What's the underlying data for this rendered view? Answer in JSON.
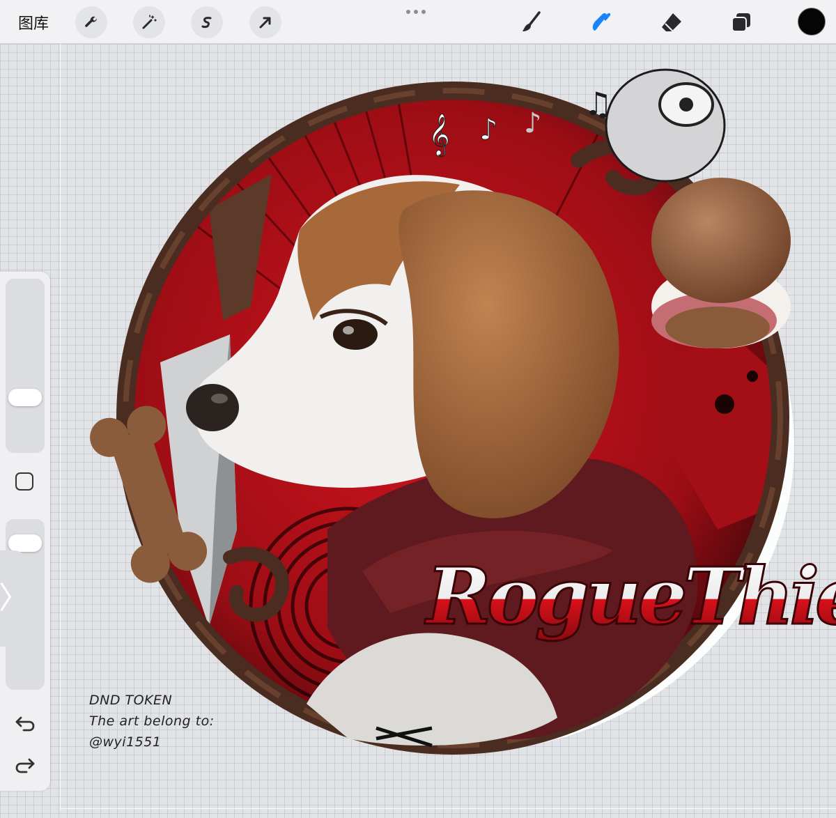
{
  "toolbar": {
    "gallery_label": "图库",
    "left_tools": [
      "wrench-icon",
      "magic-wand-icon",
      "selection-icon",
      "move-arrow-icon"
    ],
    "right_tools": [
      "brush-icon",
      "smudge-icon",
      "eraser-icon",
      "layers-icon"
    ],
    "active_tool": "smudge-icon",
    "current_color": "#050505",
    "accent_color": "#1a84ff"
  },
  "sidebar": {
    "brush_size_level": 0.3,
    "opacity_level": 0.9,
    "undo_icon": "undo-icon",
    "redo_icon": "redo-icon"
  },
  "artwork": {
    "title": "RogueThief",
    "note_lines": [
      "DND TOKEN",
      "The art belong to:",
      "@wyi1551"
    ],
    "colors": {
      "red": "#b5121b",
      "dark_red": "#5a0b10",
      "wood": "#4a2d20",
      "fur_brown": "#a8693a",
      "fur_white": "#f2f0ee",
      "scarf": "#5e1a1e"
    }
  }
}
